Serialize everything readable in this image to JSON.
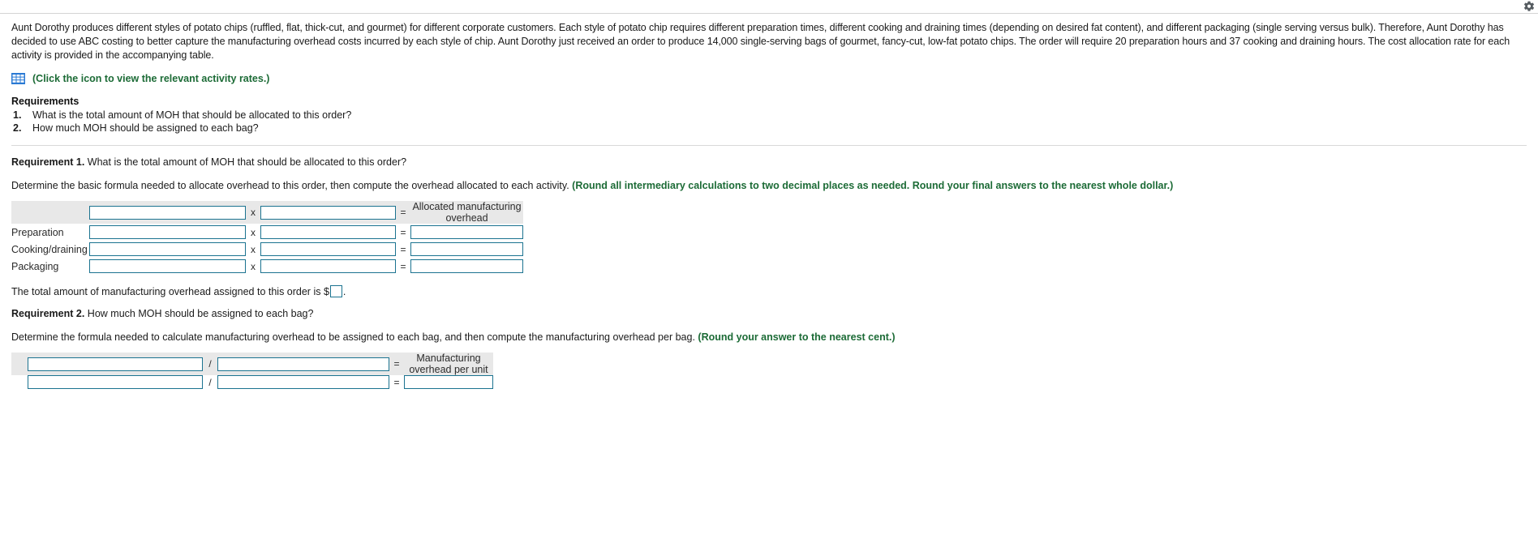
{
  "topbar": {
    "gear_icon": "gear-icon"
  },
  "problem": {
    "paragraph": "Aunt Dorothy produces different styles of potato chips (ruffled, flat, thick-cut, and gourmet) for different corporate customers. Each style of potato chip requires different preparation times, different cooking and draining times (depending on desired fat content), and different packaging (single serving versus bulk). Therefore, Aunt Dorothy has decided to use ABC costing to better capture the manufacturing overhead costs incurred by each style of chip. Aunt Dorothy just received an order to produce 14,000 single-serving bags of gourmet, fancy-cut, low-fat potato chips. The order will require 20 preparation hours and 37 cooking and draining hours. The cost allocation rate for each activity is provided in the accompanying table.",
    "icon_name": "table-grid-icon",
    "icon_link_text": "(Click the icon to view the relevant activity rates.)",
    "icon_color": "#1c6b36"
  },
  "requirements": {
    "heading": "Requirements",
    "items": [
      {
        "num": "1.",
        "text": "What is the total amount of MOH that should be allocated to this order?"
      },
      {
        "num": "2.",
        "text": "How much MOH should be assigned to each bag?"
      }
    ]
  },
  "requirement1": {
    "label": "Requirement 1.",
    "question": "What is the total amount of MOH that should be allocated to this order?",
    "instruction": "Determine the basic formula needed to allocate overhead to this order, then compute the overhead allocated to each activity.",
    "hint": "(Round all intermediary calculations to two decimal places as needed. Round your final answers to the nearest whole dollar.)",
    "table": {
      "header": {
        "result_line1": "Allocated manufacturing",
        "result_line2": "overhead",
        "op1": "x",
        "op2": "="
      },
      "rows": [
        {
          "label": "Preparation",
          "factor1": "",
          "op1": "x",
          "factor2": "",
          "op2": "=",
          "result": ""
        },
        {
          "label": "Cooking/draining",
          "factor1": "",
          "op1": "x",
          "factor2": "",
          "op2": "=",
          "result": ""
        },
        {
          "label": "Packaging",
          "factor1": "",
          "op1": "x",
          "factor2": "",
          "op2": "=",
          "result": ""
        }
      ],
      "header_row": {
        "factor1": "",
        "factor2": ""
      }
    },
    "total_prefix": "The total amount of manufacturing overhead assigned to this order is $",
    "total_value": "",
    "total_suffix": "."
  },
  "requirement2": {
    "label": "Requirement 2.",
    "question": "How much MOH should be assigned to each bag?",
    "instruction": "Determine the formula needed to calculate manufacturing overhead to be assigned to each bag, and then compute the manufacturing overhead per bag.",
    "hint": "(Round your answer to the nearest cent.)",
    "table": {
      "header": {
        "result_line1": "Manufacturing",
        "result_line2": "overhead per unit",
        "op1": "/",
        "op2": "="
      },
      "rows": [
        {
          "numerator": "",
          "op1": "/",
          "denominator": "",
          "op2": "=",
          "result": ""
        }
      ],
      "header_row": {
        "numerator": "",
        "denominator": ""
      }
    }
  },
  "colors": {
    "field_border": "#1b7390",
    "band": "#e8e8e8",
    "hint_green": "#1c6b36",
    "icon_blue": "#2a7ad4"
  }
}
